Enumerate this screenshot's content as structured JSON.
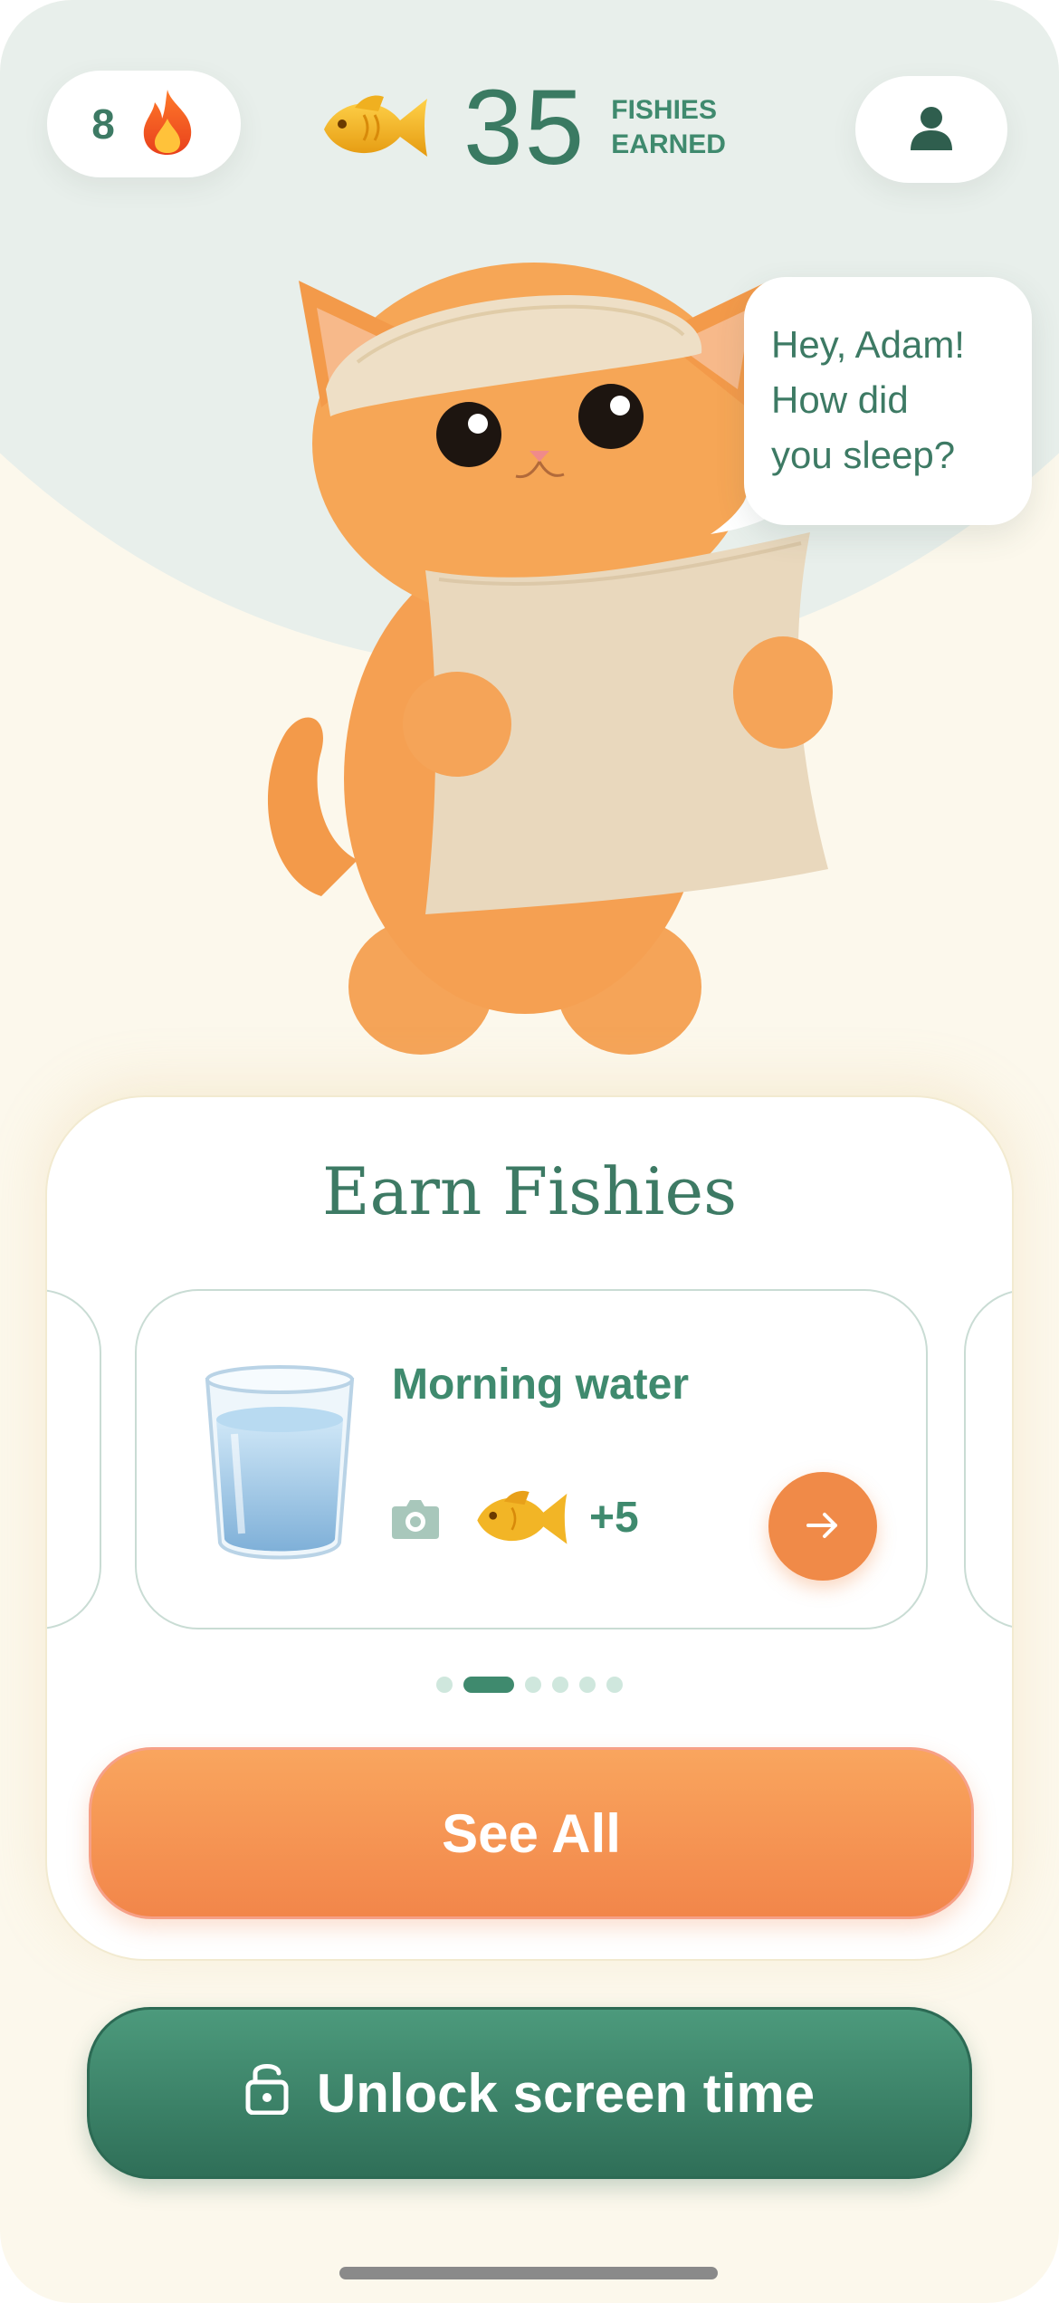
{
  "header": {
    "streak_count": "8",
    "streak_icon": "flame-icon",
    "fishies_count": "35",
    "fishies_label_line1": "FISHIES",
    "fishies_label_line2": "EARNED",
    "fish_icon": "golden-fish-icon",
    "profile_icon": "user-icon"
  },
  "mascot": {
    "speech_line1": "Hey, Adam!",
    "speech_line2": "How did",
    "speech_line3": "you sleep?"
  },
  "earn_card": {
    "title": "Earn Fishies",
    "tasks": [
      {
        "title": "Morning water",
        "reward": "+5",
        "icon": "water-glass-icon",
        "proof_icon": "camera-icon"
      }
    ],
    "carousel_pages": 6,
    "carousel_active_index": 1,
    "see_all_label": "See All"
  },
  "footer": {
    "unlock_label": "Unlock screen time",
    "unlock_icon": "lock-icon"
  },
  "colors": {
    "primary_green": "#3d7a64",
    "accent_orange": "#f08a48",
    "background_cream": "#fcf8ec",
    "top_mint": "#e8efeb"
  }
}
